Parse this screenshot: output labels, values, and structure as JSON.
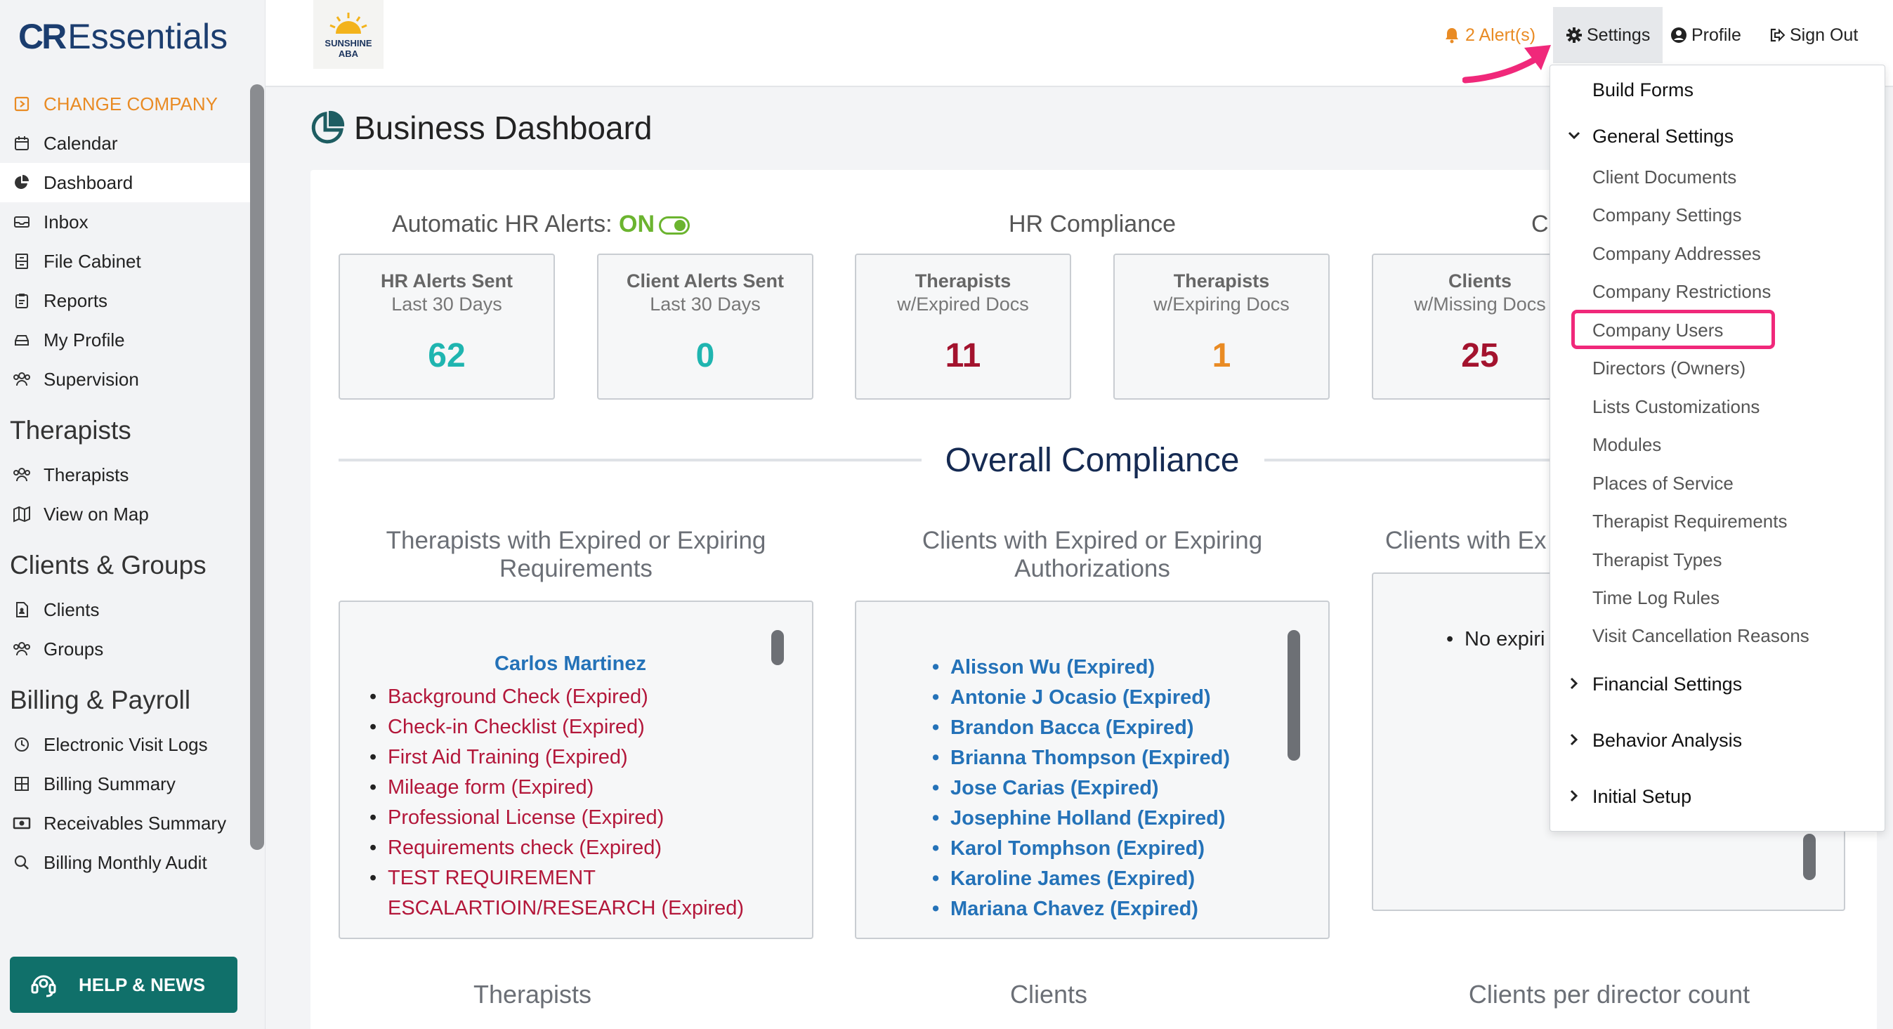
{
  "app": {
    "logo_cr": "CR",
    "logo_text": "Essentials"
  },
  "company_logo": {
    "line1": "SUNSHINE",
    "line2": "ABA"
  },
  "topbar": {
    "alerts": "2 Alert(s)",
    "settings": "Settings",
    "profile": "Profile",
    "signout": "Sign Out"
  },
  "sidebar": {
    "change_company": "CHANGE COMPANY",
    "items_top": [
      "Calendar",
      "Dashboard",
      "Inbox",
      "File Cabinet",
      "Reports",
      "My Profile",
      "Supervision"
    ],
    "section_therapists": "Therapists",
    "items_therapists": [
      "Therapists",
      "View on Map"
    ],
    "section_clients": "Clients & Groups",
    "items_clients": [
      "Clients",
      "Groups"
    ],
    "section_billing": "Billing & Payroll",
    "items_billing": [
      "Electronic Visit Logs",
      "Billing Summary",
      "Receivables Summary",
      "Billing Monthly Audit"
    ],
    "help": "HELP & NEWS"
  },
  "page": {
    "title": "Business Dashboard"
  },
  "sections": {
    "auto_hr_label": "Automatic HR Alerts: ",
    "auto_hr_state": "ON",
    "hr_compliance": "HR Compliance",
    "clients_partial": "C"
  },
  "stats": [
    {
      "title": "HR Alerts Sent",
      "sub": "Last 30 Days",
      "value": "62",
      "color": "#1fb5b0"
    },
    {
      "title": "Client Alerts Sent",
      "sub": "Last 30 Days",
      "value": "0",
      "color": "#1fb5b0"
    },
    {
      "title": "Therapists",
      "sub": "w/Expired Docs",
      "value": "11",
      "color": "#a3132e"
    },
    {
      "title": "Therapists",
      "sub": "w/Expiring Docs",
      "value": "1",
      "color": "#e98b24"
    },
    {
      "title": "Clients",
      "sub": "w/Missing Docs",
      "value": "25",
      "color": "#a3132e"
    }
  ],
  "overall": {
    "title": "Overall Compliance"
  },
  "col_therapists": {
    "title_line1": "Therapists with Expired or Expiring",
    "title_line2": "Requirements",
    "therapist_name": "Carlos Martinez",
    "items": [
      "Background Check (Expired)",
      "Check-in Checklist (Expired)",
      "First Aid Training (Expired)",
      "Mileage form (Expired)",
      "Professional License (Expired)",
      "Requirements check (Expired)",
      "TEST REQUIREMENT",
      "ESCALARTIOIN/RESEARCH (Expired)"
    ]
  },
  "col_clients": {
    "title_line1": "Clients with Expired or Expiring",
    "title_line2": "Authorizations",
    "items": [
      "Alisson Wu (Expired)",
      "Antonie J Ocasio (Expired)",
      "Brandon Bacca (Expired)",
      "Brianna Thompson (Expired)",
      "Jose Carias (Expired)",
      "Josephine Holland (Expired)",
      "Karol Tomphson (Expired)",
      "Karoline James (Expired)",
      "Mariana Chavez (Expired)"
    ]
  },
  "col_third": {
    "title_partial": "Clients with Ex",
    "item_partial": "No expiri"
  },
  "bottom": {
    "therapists": "Therapists",
    "clients": "Clients",
    "per_director": "Clients per director count"
  },
  "dropdown": {
    "build_forms": "Build Forms",
    "general_settings": "General Settings",
    "general_items": [
      "Client Documents",
      "Company Settings",
      "Company Addresses",
      "Company Restrictions",
      "Company Users",
      "Directors (Owners)",
      "Lists Customizations",
      "Modules",
      "Places of Service",
      "Therapist Requirements",
      "Therapist Types",
      "Time Log Rules",
      "Visit Cancellation Reasons"
    ],
    "financial_settings": "Financial Settings",
    "behavior_analysis": "Behavior Analysis",
    "initial_setup": "Initial Setup"
  }
}
